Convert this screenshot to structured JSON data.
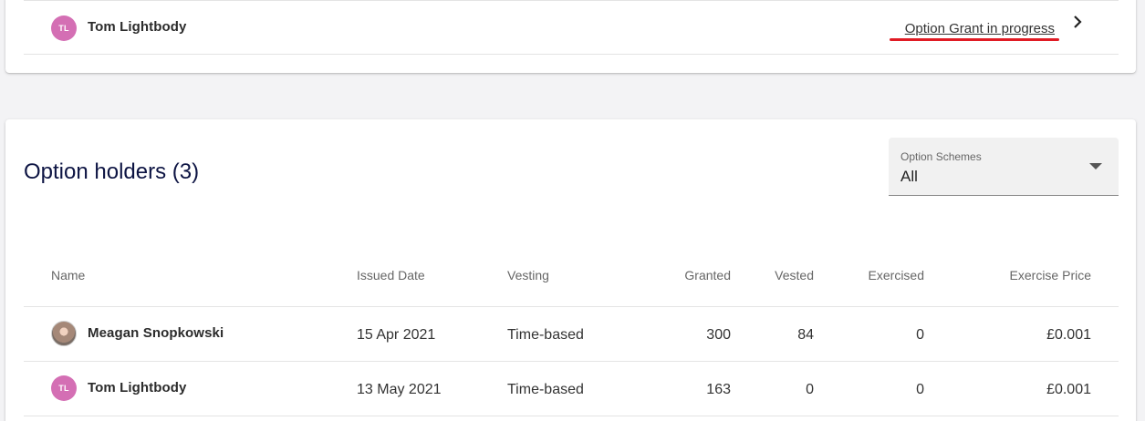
{
  "top_card": {
    "initials": "TL",
    "name": "Tom Lightbody",
    "status": "Option Grant in progress"
  },
  "option_holders": {
    "title": "Option holders (3)",
    "filter": {
      "label": "Option Schemes",
      "value": "All"
    },
    "columns": [
      "Name",
      "Issued Date",
      "Vesting",
      "Granted",
      "Vested",
      "Exercised",
      "Exercise Price"
    ],
    "rows": [
      {
        "avatar": "photo",
        "initials": "",
        "name": "Meagan Snopkowski",
        "issued": "15 Apr 2021",
        "vesting": "Time-based",
        "granted": "300",
        "vested": "84",
        "exercised": "0",
        "price": "£0.001"
      },
      {
        "avatar": "initials",
        "initials": "TL",
        "name": "Tom Lightbody",
        "issued": "13 May 2021",
        "vesting": "Time-based",
        "granted": "163",
        "vested": "0",
        "exercised": "0",
        "price": "£0.001"
      }
    ]
  },
  "colors": {
    "accent_avatar": "#d46fb4",
    "title": "#0d1443",
    "highlight": "#e01b24"
  },
  "icons": {
    "row_chevron": "chevron-right-icon",
    "select_caret": "caret-down-icon"
  }
}
